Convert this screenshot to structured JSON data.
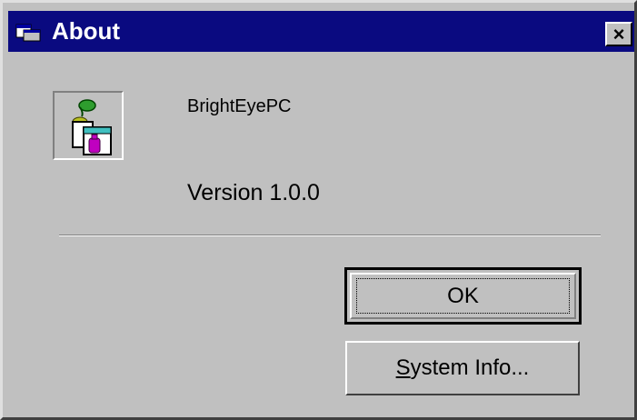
{
  "window": {
    "title": "About",
    "close_glyph": "×",
    "colors": {
      "titlebar": "#0a0a80",
      "face": "#c0c0c0",
      "text": "#000000"
    }
  },
  "app": {
    "icon": "app-logo-icon",
    "name": "BrightEyePC",
    "version": "Version 1.0.0"
  },
  "buttons": {
    "ok": "OK",
    "system_info_mnemonic": "S",
    "system_info_rest": "ystem Info..."
  }
}
